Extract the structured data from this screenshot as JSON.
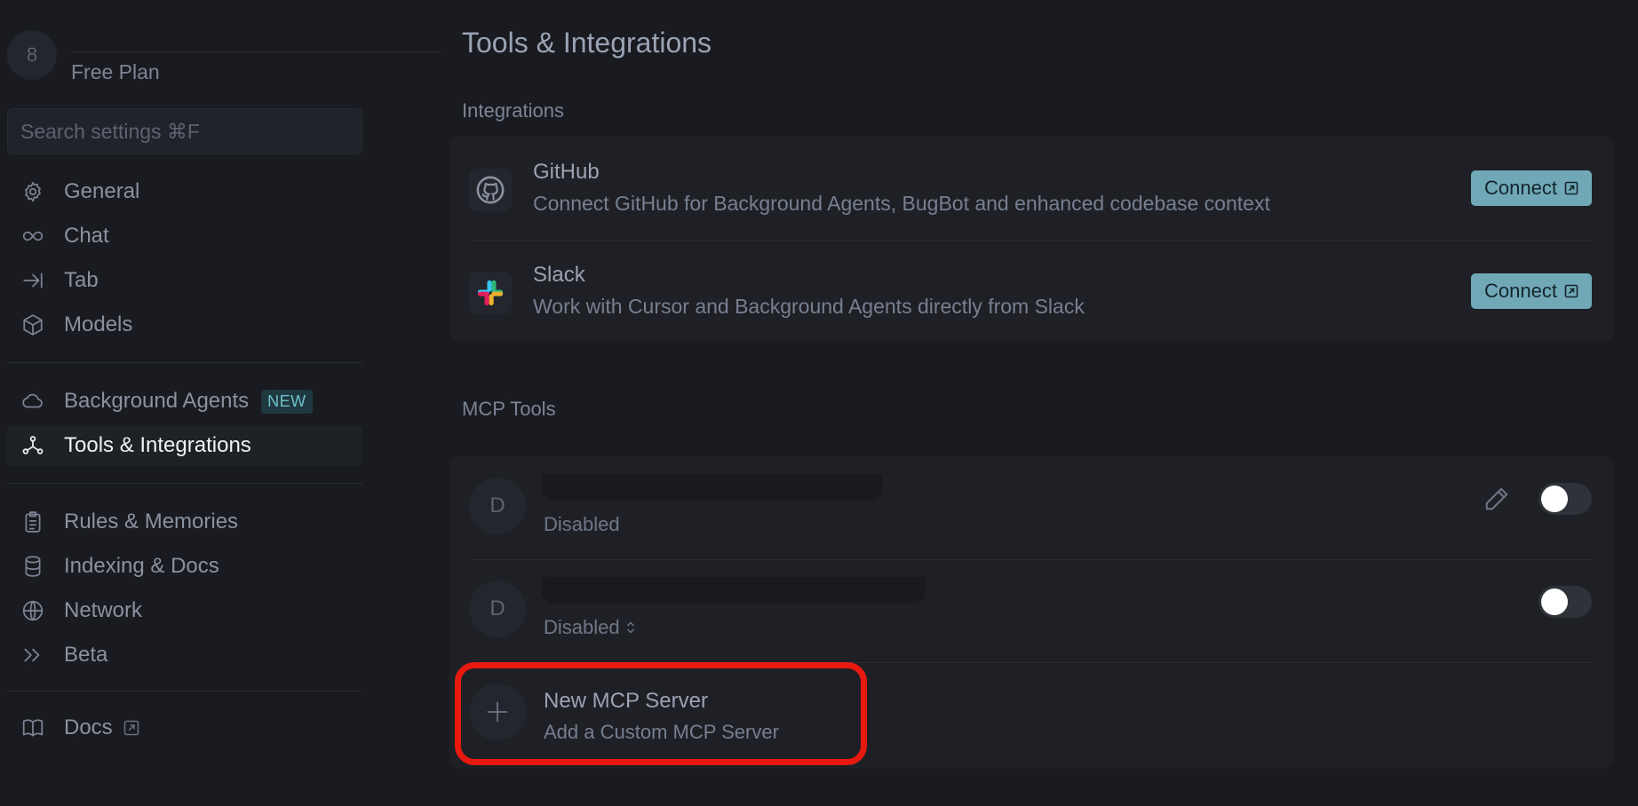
{
  "account": {
    "avatar_initial": "8",
    "plan": "Free Plan"
  },
  "search": {
    "placeholder": "Search settings ⌘F"
  },
  "sidebar": {
    "items": [
      {
        "label": "General",
        "icon": "gear-icon"
      },
      {
        "label": "Chat",
        "icon": "infinity-icon"
      },
      {
        "label": "Tab",
        "icon": "tab-arrow-icon"
      },
      {
        "label": "Models",
        "icon": "cube-icon"
      },
      {
        "label": "Background Agents",
        "icon": "cloud-icon",
        "badge": "NEW"
      },
      {
        "label": "Tools & Integrations",
        "icon": "network-icon",
        "active": true
      },
      {
        "label": "Rules & Memories",
        "icon": "clipboard-icon"
      },
      {
        "label": "Indexing & Docs",
        "icon": "database-icon"
      },
      {
        "label": "Network",
        "icon": "globe-icon"
      },
      {
        "label": "Beta",
        "icon": "double-chevron-icon"
      },
      {
        "label": "Docs",
        "icon": "book-icon"
      }
    ]
  },
  "page": {
    "title": "Tools & Integrations"
  },
  "integrations": {
    "label": "Integrations",
    "items": [
      {
        "name": "GitHub",
        "description": "Connect GitHub for Background Agents, BugBot and enhanced codebase context",
        "button": "Connect",
        "icon": "github-icon"
      },
      {
        "name": "Slack",
        "description": "Work with Cursor and Background Agents directly from Slack",
        "button": "Connect",
        "icon": "slack-icon"
      }
    ]
  },
  "mcp": {
    "label": "MCP Tools",
    "servers": [
      {
        "initial": "D",
        "status": "Disabled",
        "enabled": false
      },
      {
        "initial": "D",
        "status": "Disabled",
        "enabled": false
      }
    ],
    "new_server": {
      "title": "New MCP Server",
      "subtitle": "Add a Custom MCP Server"
    }
  },
  "colors": {
    "highlight": "#e8190e",
    "connect_button": "#70a8b8",
    "badge": "#6fc0cc"
  }
}
